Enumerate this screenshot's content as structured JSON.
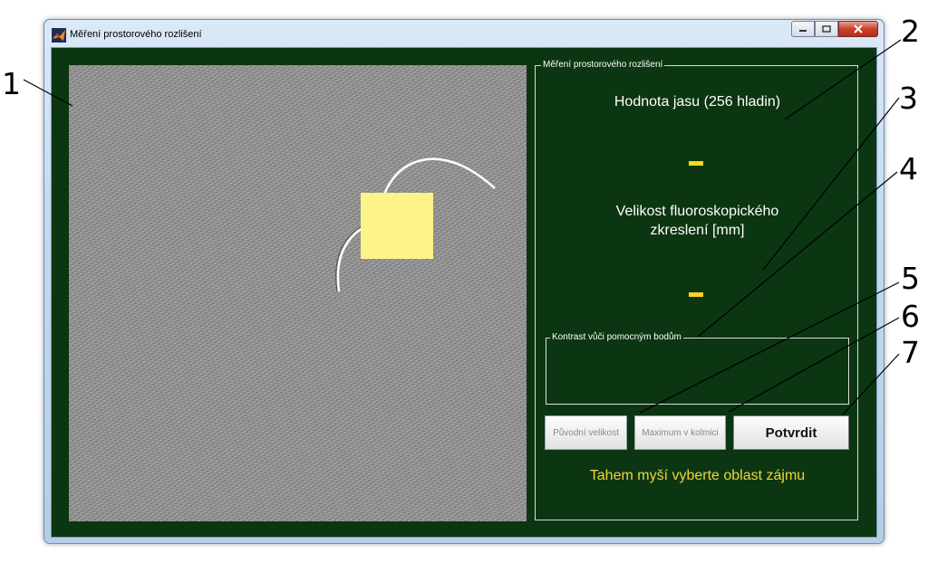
{
  "window": {
    "title": "Měření prostorového rozlišení"
  },
  "panel": {
    "group_label": "Měření prostorového rozlišení",
    "brightness_label": "Hodnota jasu (256 hladin)",
    "brightness_value": "-",
    "blur_label_line1": "Velikost fluoroskopického",
    "blur_label_line2": "zkreslení [mm]",
    "blur_value": "-",
    "contrast_group_label": "Kontrast vůči pomocným bodům",
    "buttons": {
      "original_size": "Původní velikost",
      "maximum_perpendicular": "Maximum v kolmici",
      "confirm": "Potvrdit"
    },
    "hint": "Tahem myší vyberte oblast zájmu"
  },
  "annotations": [
    "1",
    "2",
    "3",
    "4",
    "5",
    "6",
    "7"
  ],
  "colors": {
    "client_background": "#0c3611",
    "value_accent": "#ffd420",
    "hint_text": "#f2d33c",
    "roi_fill": "#fdf389"
  },
  "icons": [
    "matlab-icon",
    "minimize-icon",
    "maximize-icon",
    "close-icon"
  ]
}
